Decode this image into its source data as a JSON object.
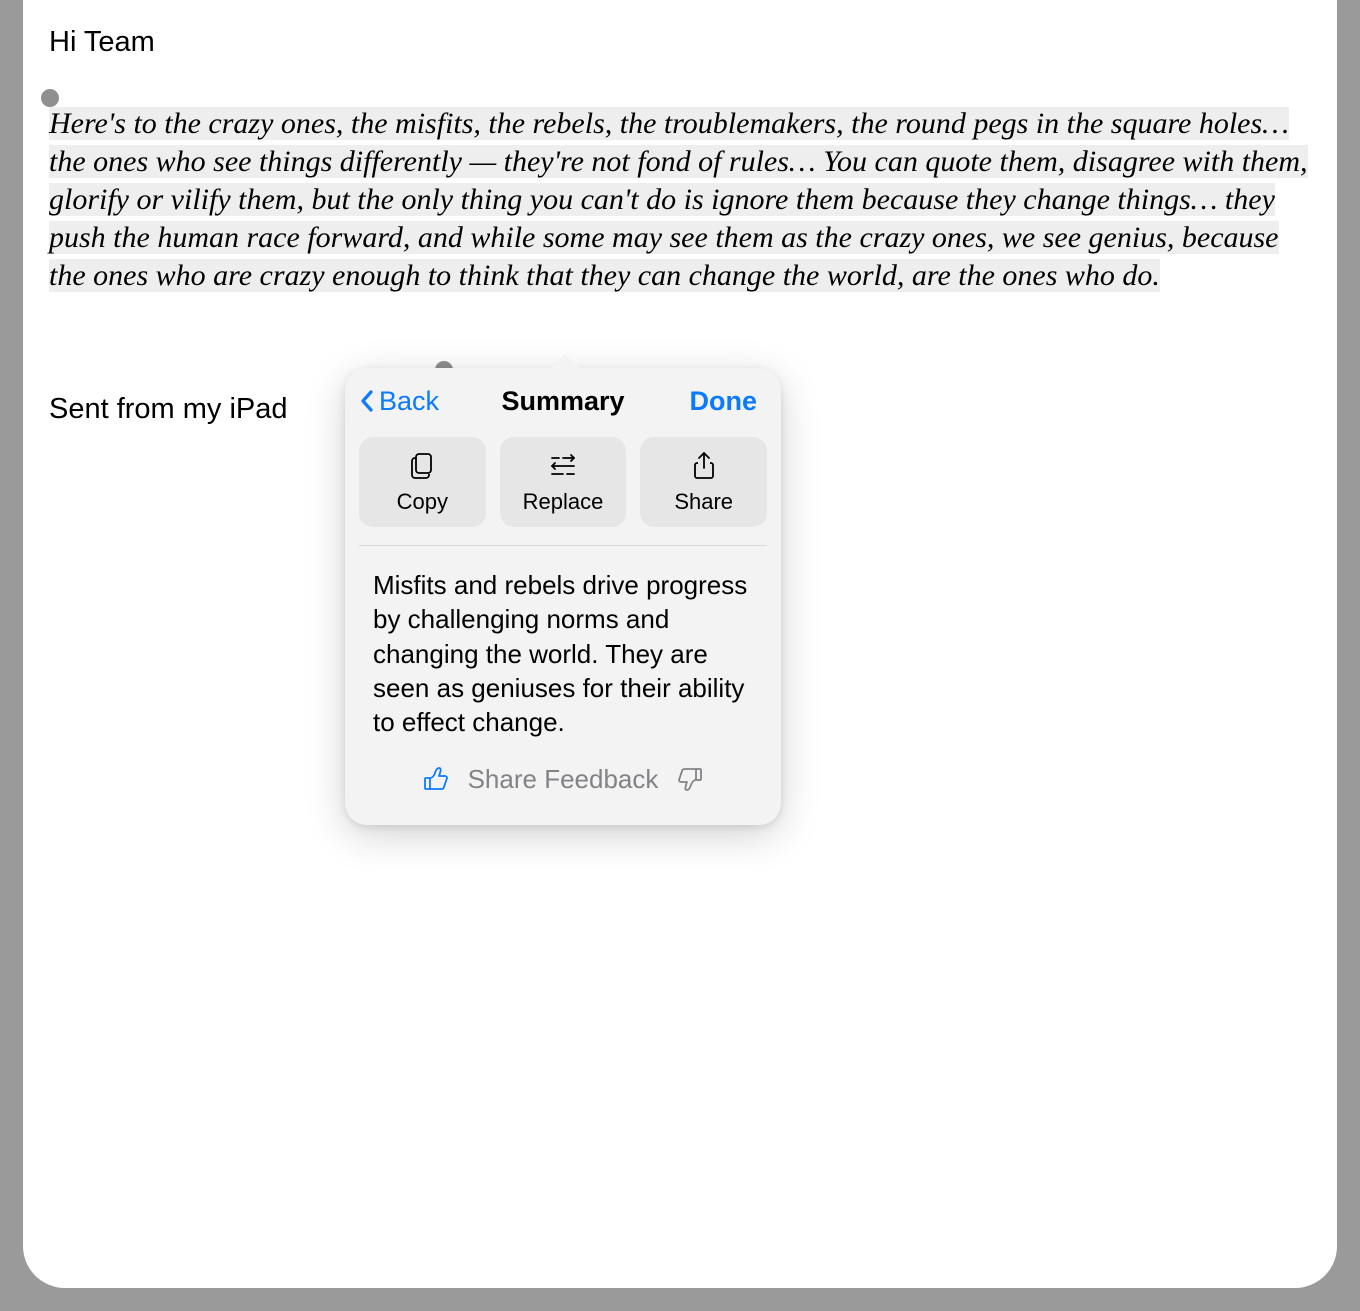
{
  "email": {
    "greeting": "Hi Team",
    "selected_text": "Here's to the crazy ones, the misfits, the rebels, the troublemakers, the round pegs in the square holes… the ones who see things differently — they're not fond of rules… You can quote them, disagree with them, glorify or vilify them, but the only thing you can't do is ignore them because they change things… they push the human race forward, and while some may see them as the crazy ones, we see genius, because the ones who are crazy enough to think that they can change the world, are the ones who do.",
    "signature": "Sent from my iPad"
  },
  "popover": {
    "back_label": "Back",
    "title": "Summary",
    "done_label": "Done",
    "actions": {
      "copy": "Copy",
      "replace": "Replace",
      "share": "Share"
    },
    "summary_text": "Misfits and rebels drive progress by challenging norms and changing the world. They are seen as geniuses for their ability to effect change.",
    "feedback_label": "Share Feedback"
  }
}
